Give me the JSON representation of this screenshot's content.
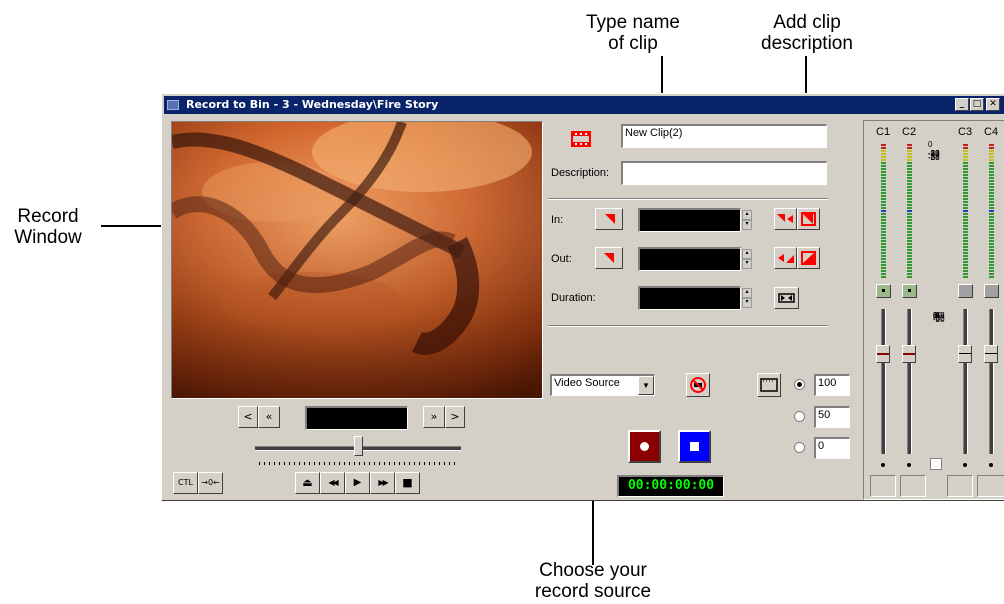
{
  "callouts": {
    "type_name": [
      "Type name",
      "of clip"
    ],
    "add_desc": [
      "Add clip",
      "description"
    ],
    "record_window": [
      "Record",
      "Window"
    ],
    "record_source": [
      "Choose your",
      "record source"
    ]
  },
  "window": {
    "title": "Record to Bin - 3 - Wednesday\\Fire Story",
    "controls": {
      "minimize": "_",
      "maximize": "□",
      "close": "✕"
    }
  },
  "clip": {
    "name_value": "New Clip(2)",
    "description_label": "Description:",
    "description_value": ""
  },
  "marks": {
    "in_label": "In:",
    "out_label": "Out:",
    "duration_label": "Duration:"
  },
  "transport": {
    "step_back": "<",
    "fast_back": "«",
    "fast_fwd": "»",
    "step_fwd": ">",
    "ctl": "CTL",
    "offset": "→0←",
    "eject": "⏏",
    "rewind": "◀◀",
    "play": "▶",
    "ffwd": "▶▶",
    "stop": "■"
  },
  "source": {
    "selected": "Video Source"
  },
  "resolution_options": [
    "100",
    "50",
    "0"
  ],
  "timecode": "00:00:00:00",
  "audio": {
    "channels": [
      "C1",
      "C2",
      "C3",
      "C4"
    ],
    "meter_scale": [
      "0",
      "-3",
      "-8",
      "-14",
      "-20",
      "-23",
      "-27",
      "-32",
      "-38",
      "-oo"
    ],
    "fader_scale": [
      "10",
      "6",
      "3",
      "0",
      "-4",
      "-8",
      "-12",
      "-20",
      "-32",
      "-oo"
    ]
  },
  "colors": {
    "title_bar": "#0a246a",
    "window_bg": "#d4d0c8",
    "record_button": "#8b0000",
    "stop_button": "#0000ff",
    "timecode_text": "#00ff00",
    "mark_icon": "#ff0000"
  }
}
